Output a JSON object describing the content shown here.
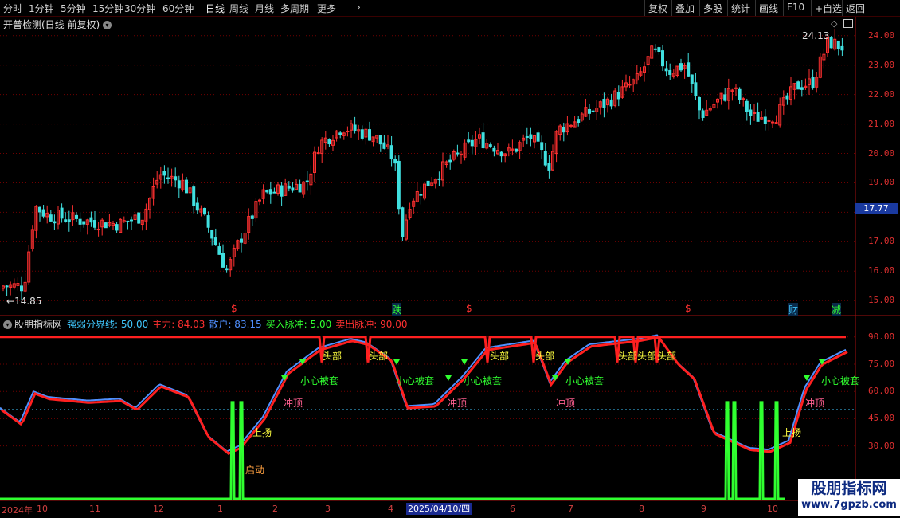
{
  "toolbar": {
    "periods": [
      "分时",
      "1分钟",
      "5分钟",
      "15分钟",
      "30分钟",
      "60分钟",
      "日线",
      "周线",
      "月线",
      "多周期",
      "更多"
    ],
    "active": "日线",
    "actions": [
      "复权",
      "叠加",
      "多股",
      "统计",
      "画线",
      "F10",
      "+自选",
      "返回"
    ]
  },
  "main_chart": {
    "title": "开普检测(日线 前复权)",
    "y_ticks": [
      "24.00",
      "23.00",
      "22.00",
      "21.00",
      "20.00",
      "19.00",
      "18.00",
      "17.00",
      "16.00",
      "15.00"
    ],
    "current_price": "17.77",
    "high_label": "24.13",
    "low_label": "14.85",
    "markers": [
      "$",
      "跌",
      "$",
      "$",
      "财",
      "减"
    ]
  },
  "indicator": {
    "name": "股朋指标网",
    "fields": [
      {
        "label": "强弱分界线:",
        "value": "50.00",
        "color": "#40c8ff"
      },
      {
        "label": "主力:",
        "value": "84.03",
        "color": "#ff3030"
      },
      {
        "label": "散户:",
        "value": "83.15",
        "color": "#5090ff"
      },
      {
        "label": "买入脉冲:",
        "value": "5.00",
        "color": "#30ff30"
      },
      {
        "label": "卖出脉冲:",
        "value": "90.00",
        "color": "#ff3030"
      }
    ],
    "y_ticks": [
      "90.00",
      "75.00",
      "60.00",
      "45.00",
      "30.00"
    ],
    "annotations": {
      "top": "头部",
      "trap": "小心被套",
      "rush": "冲顶",
      "rise": "上扬",
      "start": "启动"
    }
  },
  "date_axis": {
    "labels": [
      "2024年",
      "10",
      "11",
      "12",
      "1",
      "2",
      "3",
      "4",
      "5",
      "6",
      "7",
      "8",
      "9",
      "10"
    ],
    "cursor_date": "2025/04/10/四"
  },
  "watermark": {
    "line1": "股朋指标网",
    "line2": "www.7gpzb.com"
  }
}
